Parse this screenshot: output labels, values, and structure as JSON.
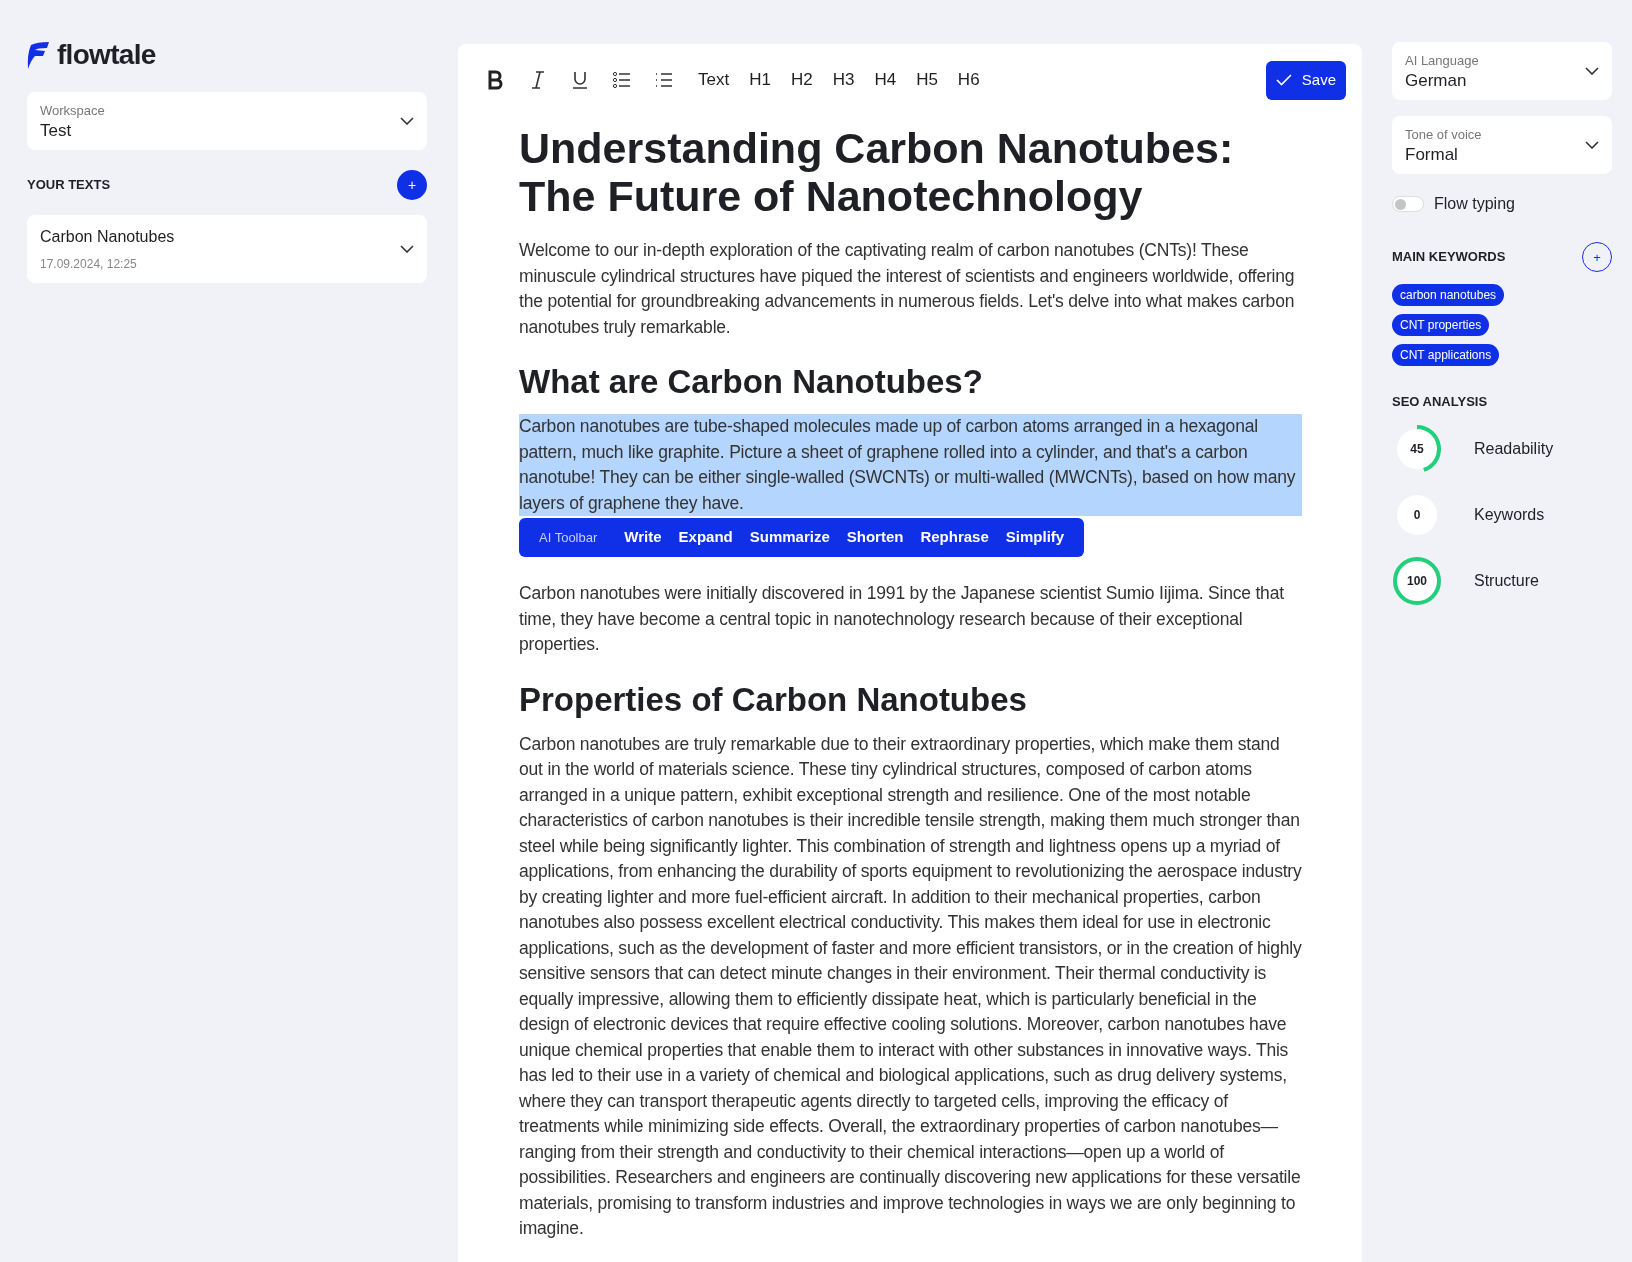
{
  "brand": {
    "name": "flowtale"
  },
  "workspace": {
    "label": "Workspace",
    "value": "Test"
  },
  "your_texts": {
    "title": "YOUR TEXTS",
    "add_button": "+",
    "items": [
      {
        "title": "Carbon Nanotubes",
        "date": "17.09.2024, 12:25"
      }
    ]
  },
  "toolbar": {
    "format_buttons": [
      {
        "kind": "bold"
      },
      {
        "kind": "italic"
      },
      {
        "kind": "underline"
      },
      {
        "kind": "bullet-list"
      },
      {
        "kind": "list"
      }
    ],
    "block_buttons": [
      "Text",
      "H1",
      "H2",
      "H3",
      "H4",
      "H5",
      "H6"
    ],
    "save": "Save"
  },
  "document": [
    {
      "kind": "h1",
      "text": "Understanding Carbon Nanotubes: The Future of Nanotechnology",
      "selected": false
    },
    {
      "kind": "p",
      "text": "Welcome to our in-depth exploration of the captivating realm of carbon nanotubes (CNTs)! These minuscule cylindrical structures have piqued the interest of scientists and engineers worldwide, offering the potential for groundbreaking advancements in numerous fields. Let's delve into what makes carbon nanotubes truly remarkable.",
      "selected": false
    },
    {
      "kind": "h2",
      "text": "What are Carbon Nanotubes?",
      "selected": false
    },
    {
      "kind": "p",
      "text": "Carbon nanotubes are tube-shaped molecules made up of carbon atoms arranged in a hexagonal pattern, much like graphite. Picture a sheet of graphene rolled into a cylinder, and that's a carbon nanotube! They can be either single-walled (SWCNTs) or multi-walled (MWCNTs), based on how many layers of graphene they have.",
      "selected": true
    },
    {
      "kind": "ai-toolbar",
      "label": "AI Toolbar",
      "actions": [
        "Write",
        "Expand",
        "Summarize",
        "Shorten",
        "Rephrase",
        "Simplify"
      ]
    },
    {
      "kind": "p",
      "text": "Carbon nanotubes were initially discovered in 1991 by the Japanese scientist Sumio Iijima. Since that time, they have become a central topic in nanotechnology research because of their exceptional properties.",
      "selected": false
    },
    {
      "kind": "h2",
      "text": "Properties of Carbon Nanotubes",
      "selected": false
    },
    {
      "kind": "p",
      "text": "Carbon nanotubes are truly remarkable due to their extraordinary properties, which make them stand out in the world of materials science. These tiny cylindrical structures, composed of carbon atoms arranged in a unique pattern, exhibit exceptional strength and resilience. One of the most notable characteristics of carbon nanotubes is their incredible tensile strength, making them much stronger than steel while being significantly lighter. This combination of strength and lightness opens up a myriad of applications, from enhancing the durability of sports equipment to revolutionizing the aerospace industry by creating lighter and more fuel-efficient aircraft. In addition to their mechanical properties, carbon nanotubes also possess excellent electrical conductivity. This makes them ideal for use in electronic applications, such as the development of faster and more efficient transistors, or in the creation of highly sensitive sensors that can detect minute changes in their environment. Their thermal conductivity is equally impressive, allowing them to efficiently dissipate heat, which is particularly beneficial in the design of electronic devices that require effective cooling solutions. Moreover, carbon nanotubes have unique chemical properties that enable them to interact with other substances in innovative ways. This has led to their use in a variety of chemical and biological applications, such as drug delivery systems, where they can transport therapeutic agents directly to targeted cells, improving the efficacy of treatments while minimizing side effects. Overall, the extraordinary properties of carbon nanotubes—ranging from their strength and conductivity to their chemical interactions—open up a world of possibilities. Researchers and engineers are continually discovering new applications for these versatile materials, promising to transform industries and improve technologies in ways we are only beginning to imagine.",
      "selected": false
    }
  ],
  "settings": {
    "ai_language": {
      "label": "AI Language",
      "value": "German"
    },
    "tone": {
      "label": "Tone of voice",
      "value": "Formal"
    },
    "flow_typing": {
      "label": "Flow typing",
      "on": false
    }
  },
  "keywords": {
    "title": "MAIN KEYWORDS",
    "add_button": "+",
    "items": [
      "carbon nanotubes",
      "CNT properties",
      "CNT applications"
    ]
  },
  "seo": {
    "title": "SEO ANALYSIS",
    "metrics": [
      {
        "score": "45",
        "label": "Readability",
        "level": 0.45
      },
      {
        "score": "0",
        "label": "Keywords",
        "level": 0
      },
      {
        "score": "100",
        "label": "Structure",
        "level": 1
      }
    ]
  }
}
